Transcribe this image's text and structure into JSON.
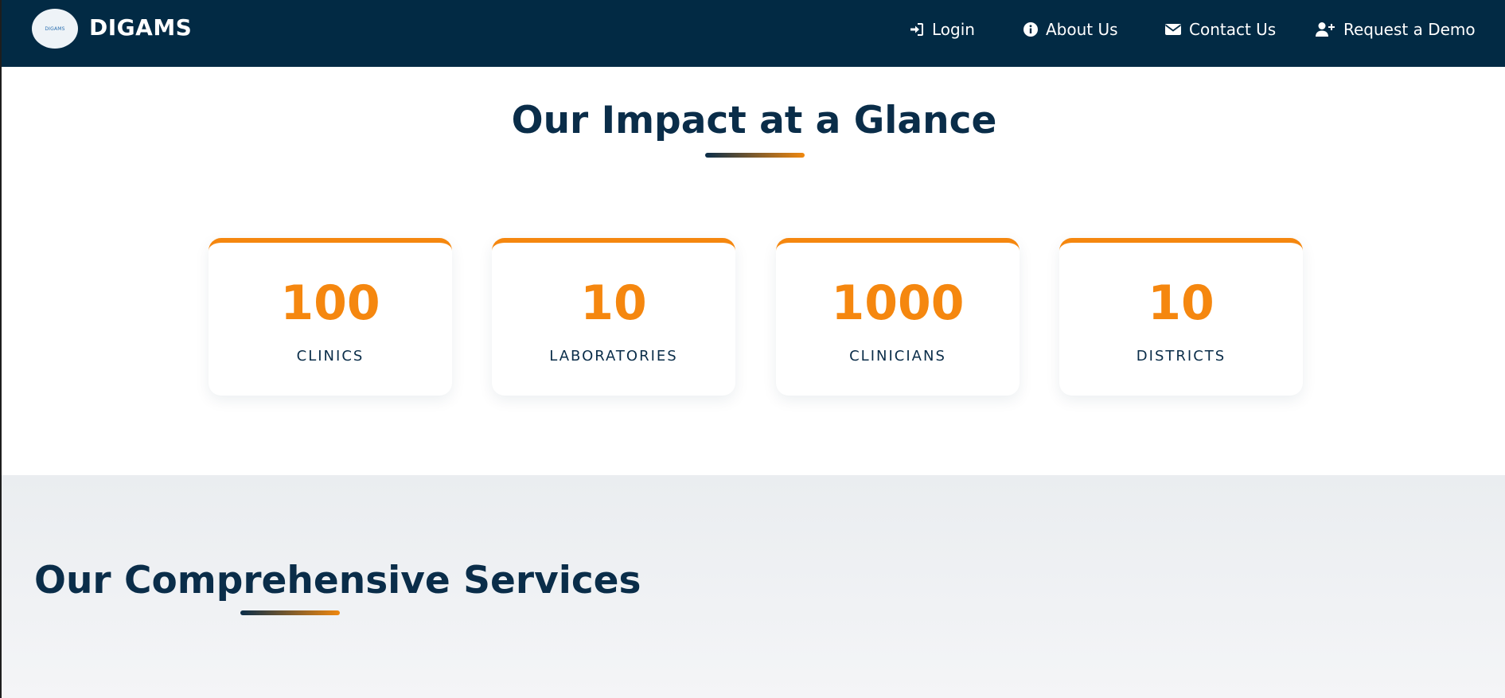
{
  "brand": {
    "name": "DIGAMS",
    "logo_text": "DIGAMS"
  },
  "nav": {
    "login": "Login",
    "about": "About Us",
    "contact": "Contact Us",
    "demo": "Request a Demo"
  },
  "impact": {
    "title": "Our Impact at a Glance",
    "stats": [
      {
        "value": "100",
        "label": "CLINICS"
      },
      {
        "value": "10",
        "label": "LABORATORIES"
      },
      {
        "value": "1000",
        "label": "CLINICIANS"
      },
      {
        "value": "10",
        "label": "DISTRICTS"
      }
    ]
  },
  "services": {
    "title": "Our Comprehensive Services"
  },
  "colors": {
    "navbar": "#022a44",
    "accent": "#f5870f",
    "heading": "#0a2d49"
  }
}
